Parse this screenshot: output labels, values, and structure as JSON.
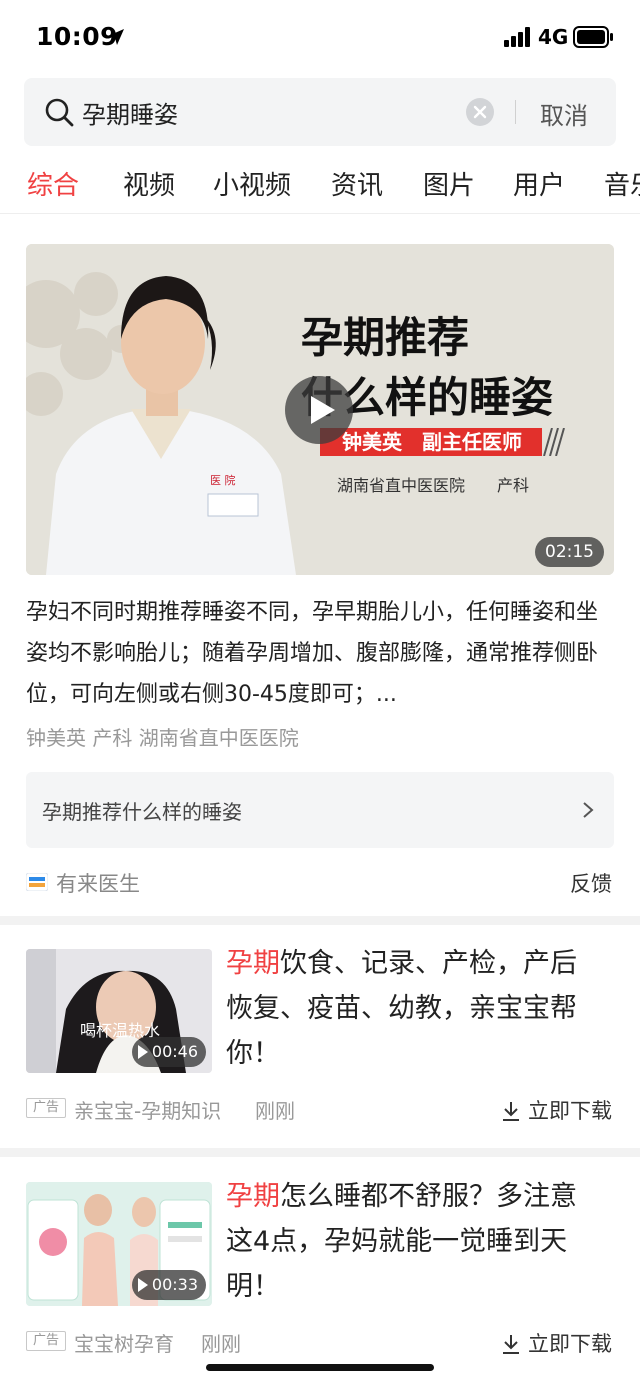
{
  "status_bar": {
    "time": "10:09",
    "network": "4G"
  },
  "search": {
    "query": "孕期睡姿",
    "cancel_label": "取消"
  },
  "tabs": [
    {
      "label": "综合",
      "active": true
    },
    {
      "label": "视频"
    },
    {
      "label": "小视频"
    },
    {
      "label": "资讯"
    },
    {
      "label": "图片"
    },
    {
      "label": "用户"
    },
    {
      "label": "音乐"
    }
  ],
  "video_card": {
    "thumb_title_line1": "孕期推荐",
    "thumb_title_line2": "什么样的睡姿",
    "doctor_bar": "钟美英　副主任医师",
    "hospital_line": "湖南省直中医医院　　产科",
    "duration": "02:15",
    "description": "孕妇不同时期推荐睡姿不同，孕早期胎儿小，任何睡姿和坐姿均不影响胎儿；随着孕周增加、腹部膨隆，通常推荐侧卧位，可向左侧或右侧30-45度即可；...",
    "meta": "钟美英 产科 湖南省直中医医院",
    "related_label": "孕期推荐什么样的睡姿",
    "source_name": "有来医生",
    "feedback_label": "反馈"
  },
  "ads": [
    {
      "title_highlight": "孕期",
      "title_rest": "饮食、记录、产检，产后恢复、疫苗、幼教，亲宝宝帮你！",
      "duration": "00:46",
      "thumb_caption": "喝杯温热水",
      "badge": "广告",
      "source": "亲宝宝-孕期知识",
      "time": "刚刚",
      "download_label": "立即下载"
    },
    {
      "title_highlight": "孕期",
      "title_rest": "怎么睡都不舒服？多注意这4点，孕妈就能一觉睡到天明！",
      "duration": "00:33",
      "badge": "广告",
      "source": "宝宝树孕育",
      "time": "刚刚",
      "download_label": "立即下载"
    }
  ],
  "colors": {
    "accent": "#f04142",
    "name_bar": "#e2302c"
  },
  "icons": [
    "location-arrow-icon",
    "signal-icon",
    "battery-icon",
    "search-icon",
    "clear-icon",
    "play-icon",
    "chevron-right-icon",
    "download-icon"
  ]
}
